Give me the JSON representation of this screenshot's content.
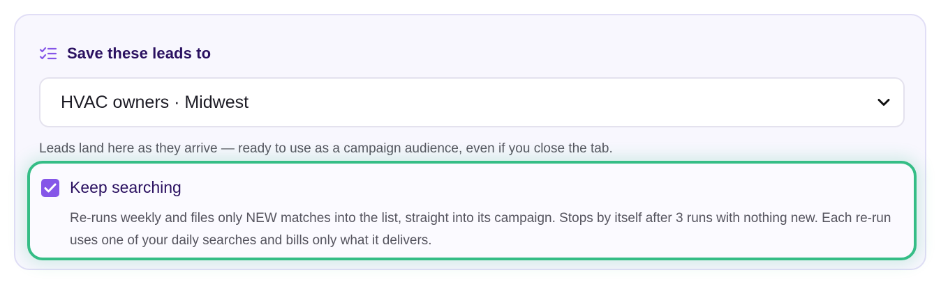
{
  "section": {
    "title": "Save these leads to",
    "icon": "list-check-icon"
  },
  "list_select": {
    "selected": "HVAC owners · Midwest",
    "icon": "chevron-down-icon"
  },
  "helper_text": "Leads land here as they arrive — ready to use as a campaign audience, even if you close the tab.",
  "keep_searching": {
    "checked": true,
    "label": "Keep searching",
    "description": "Re-runs weekly and files only NEW matches into the list, straight into its campaign. Stops by itself after 3 runs with nothing new. Each re-run uses one of your daily searches and bills only what it delivers."
  },
  "colors": {
    "accent": "#8556e8",
    "title": "#2a1060",
    "highlight_border": "#35bd86"
  }
}
